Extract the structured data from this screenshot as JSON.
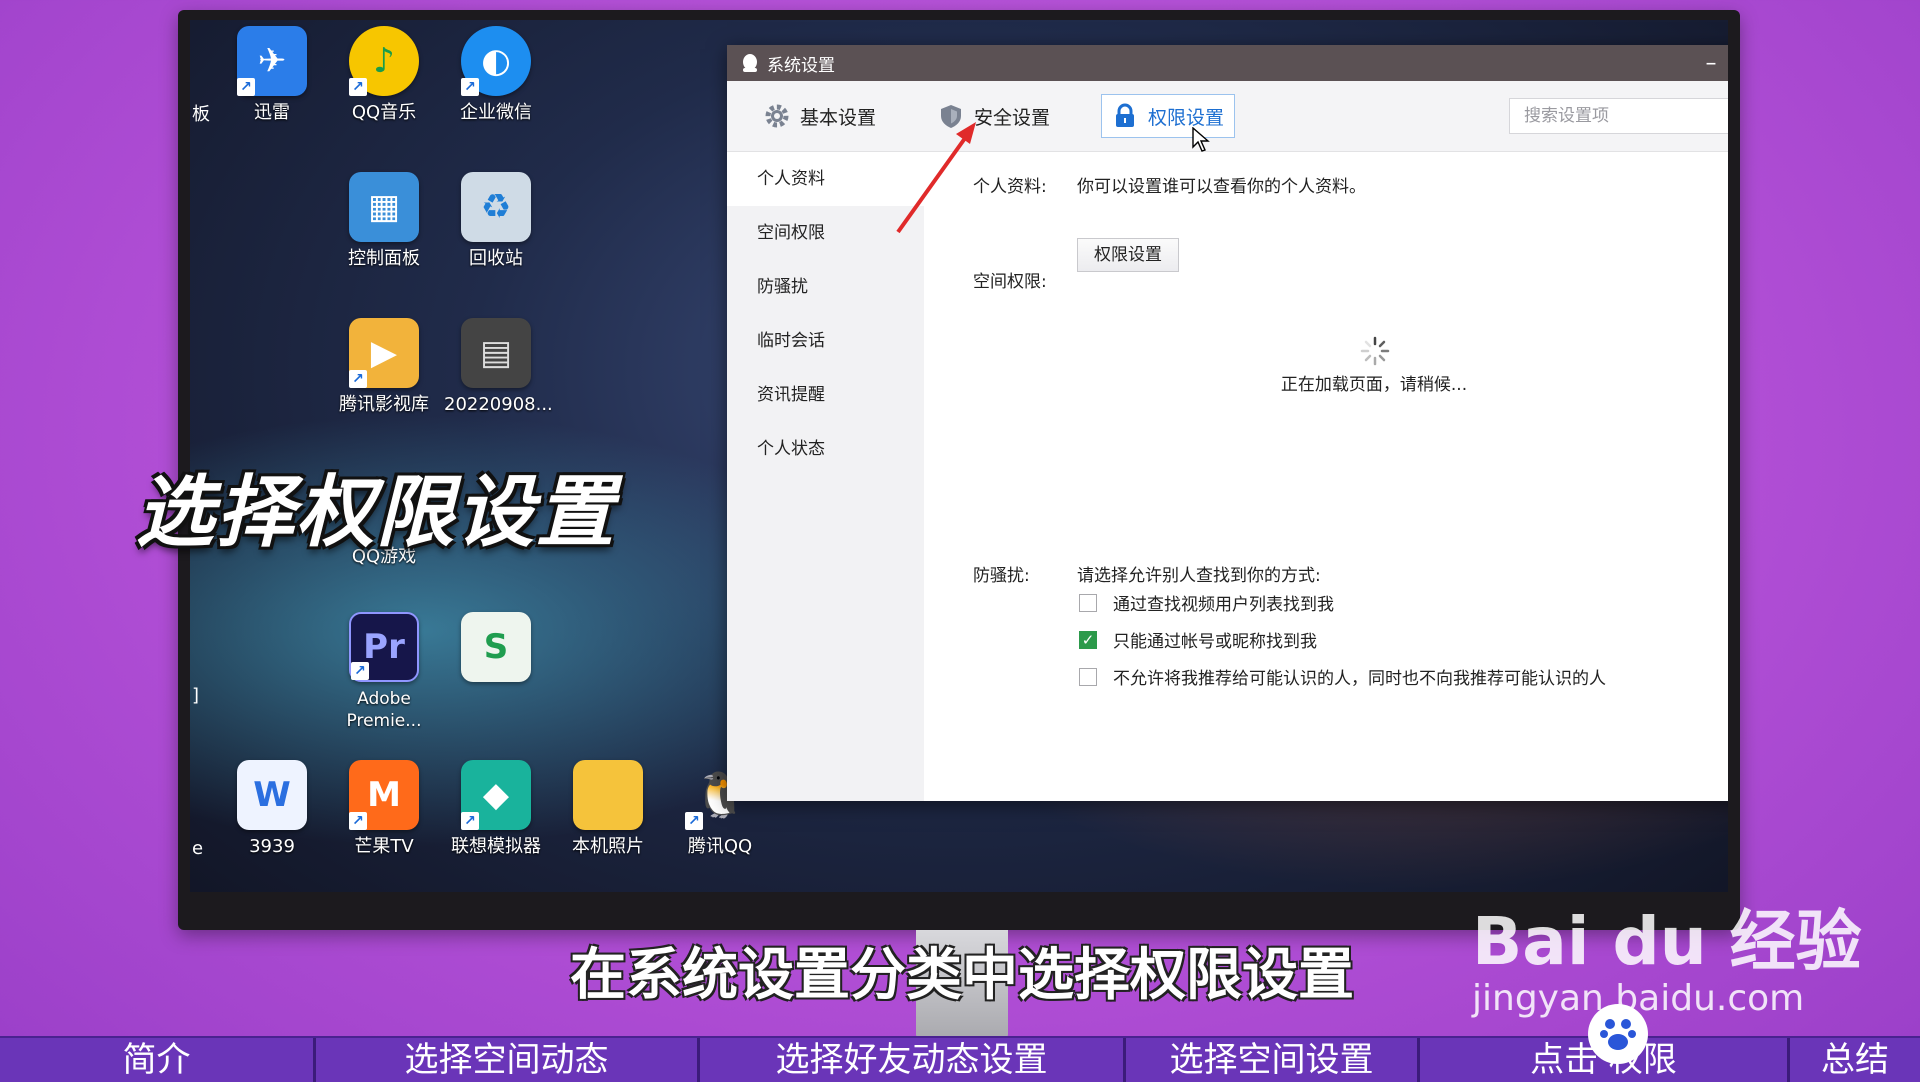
{
  "desktop_icons": [
    {
      "name": "xunlei",
      "label": "迅雷",
      "color": "#2b7de9",
      "glyph": "✈"
    },
    {
      "name": "qqmusic",
      "label": "QQ音乐",
      "color": "#f7c600",
      "glyph": "♪"
    },
    {
      "name": "wecom",
      "label": "企业微信",
      "color": "#1d8ef0",
      "glyph": "◐"
    },
    {
      "name": "control-panel",
      "label": "控制面板",
      "color": "#3a8fd9",
      "glyph": "▦"
    },
    {
      "name": "recycle-bin",
      "label": "回收站",
      "color": "#9fb6c9",
      "glyph": "♻"
    },
    {
      "name": "tencent-video-lib",
      "label": "腾讯影视库",
      "color": "#f2b33b",
      "glyph": "▶"
    },
    {
      "name": "video-file",
      "label": "20220908...",
      "color": "#444",
      "glyph": "▤"
    },
    {
      "name": "qq-game",
      "label": "QQ游戏",
      "color": "#333",
      "glyph": ""
    },
    {
      "name": "premiere",
      "label": "Adobe Premie...",
      "color": "#16164a",
      "glyph": "Pr"
    },
    {
      "name": "sheet-file",
      "label": "",
      "color": "#e8f2e9",
      "glyph": "S"
    },
    {
      "name": "doc-3939",
      "label": "3939",
      "color": "#e6efff",
      "glyph": "W"
    },
    {
      "name": "mango-tv",
      "label": "芒果TV",
      "color": "#ff6a1a",
      "glyph": "M"
    },
    {
      "name": "lenovo-emulator",
      "label": "联想模拟器",
      "color": "#19b39c",
      "glyph": "◆"
    },
    {
      "name": "photos",
      "label": "本机照片",
      "color": "#f5c33b",
      "glyph": ""
    },
    {
      "name": "tencent-qq",
      "label": "腾讯QQ",
      "color": "#222",
      "glyph": "🐧"
    }
  ],
  "edge_labels": {
    "top": "板",
    "mid": "]",
    "bottom": "e"
  },
  "dialog": {
    "title": "系统设置",
    "minimize": "–",
    "close": "✕",
    "tabs": [
      {
        "label": "基本设置"
      },
      {
        "label": "安全设置"
      },
      {
        "label": "权限设置"
      }
    ],
    "search_placeholder": "搜索设置项",
    "sidebar": [
      "个人资料",
      "空间权限",
      "防骚扰",
      "临时会话",
      "资讯提醒",
      "个人状态"
    ],
    "profile_label": "个人资料:",
    "profile_desc": "你可以设置谁可以查看你的个人资料。",
    "profile_button": "权限设置",
    "space_label": "空间权限:",
    "loading_text": "正在加载页面，请稍候...",
    "harass_label": "防骚扰:",
    "harass_desc": "请选择允许别人查找到你的方式:",
    "options": [
      {
        "label": "通过查找视频用户列表找到我",
        "checked": false
      },
      {
        "label": "只能通过帐号或昵称找到我",
        "checked": true
      },
      {
        "label": "不允许将我推荐给可能认识的人，同时也不向我推荐可能认识的人",
        "checked": false
      }
    ]
  },
  "overlay": {
    "caption": "选择权限设置",
    "subtitle": "在系统设置分类中选择权限设置",
    "watermark_brand": "Bai du 经验",
    "watermark_url": "jingyan.baidu.com"
  },
  "bottom_nav": [
    {
      "label": "简介"
    },
    {
      "label": "选择空间动态"
    },
    {
      "label": "选择好友动态设置"
    },
    {
      "label": "选择空间设置"
    },
    {
      "label": "点击   权限"
    },
    {
      "label": "总结"
    }
  ],
  "colors": {
    "accent": "#1d6fd1",
    "titlebar": "#5b5154",
    "nav": "#6a35b8",
    "checked": "#2c9a4b"
  }
}
